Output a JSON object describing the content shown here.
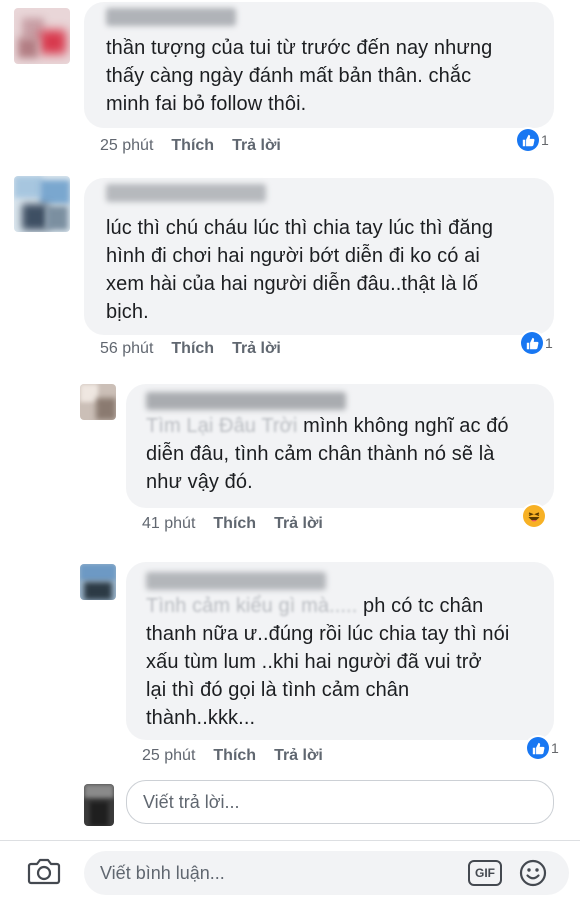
{
  "comments": [
    {
      "text_lines": [
        "thần tượng của tui từ trước đến nay nhưng",
        "thấy càng ngày đánh mất bản thân.  chắc",
        "minh fai bỏ follow thôi."
      ],
      "time": "25 phút",
      "like_label": "Thích",
      "reply_label": "Trả lời",
      "reaction": "like",
      "reaction_count": "1"
    },
    {
      "text_lines": [
        "lúc thì chú cháu lúc thì chia tay lúc thì đăng",
        "hình đi chơi hai người bớt diễn đi ko có ai",
        "xem hài của hai người diễn đâu..thật là lố",
        "bịch."
      ],
      "time": "56 phút",
      "like_label": "Thích",
      "reply_label": "Trả lời",
      "reaction": "like",
      "reaction_count": "1"
    },
    {
      "text_lines": [
        "mình không nghĩ ac đó",
        "diễn đâu, tình cảm chân thành nó sẽ là",
        "như vậy đó."
      ],
      "time": "41 phút",
      "like_label": "Thích",
      "reply_label": "Trả lời",
      "reaction": "haha",
      "reaction_count": ""
    },
    {
      "text_lines": [
        "ph có tc chân",
        "thanh nữa ư..đúng rồi lúc chia tay thì nói",
        "xấu tùm lum ..khi  hai người đã vui trở",
        "lại thì đó gọi là tình cảm chân",
        "thành..kkk..."
      ],
      "time": "25 phút",
      "like_label": "Thích",
      "reply_label": "Trả lời",
      "reaction": "like",
      "reaction_count": "1"
    }
  ],
  "reply_input": {
    "placeholder": "Viết trả lời..."
  },
  "bottom_bar": {
    "placeholder": "Viết bình luận...",
    "icons": [
      "camera-icon",
      "gif-icon",
      "emoji-icon"
    ],
    "gif_label": "GIF"
  },
  "colors": {
    "like_blue": "#1877f2",
    "bubble_bg": "#f2f3f5",
    "meta_gray": "#606770"
  }
}
